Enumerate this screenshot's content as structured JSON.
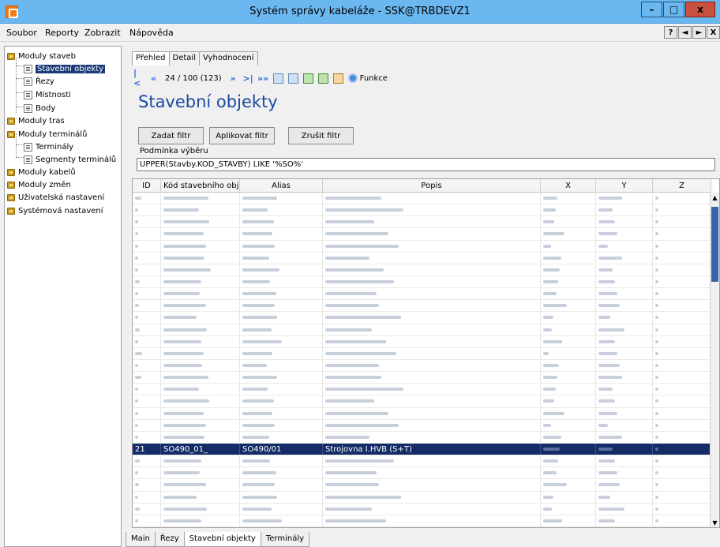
{
  "window": {
    "title": "Systém správy kabeláže - SSK@TRBDEVZ1"
  },
  "menu": [
    "Soubor",
    "Reporty",
    "Zobrazit",
    "Nápověda"
  ],
  "menu_right": [
    "?",
    "◄",
    "►",
    "X"
  ],
  "tree": {
    "modules_buildings": "Moduly staveb",
    "building_objects": "Stavební objekty",
    "sections": "Řezy",
    "rooms": "Místnosti",
    "points": "Body",
    "modules_routes": "Moduly tras",
    "modules_terminals": "Moduly terminálů",
    "terminals": "Terminály",
    "terminal_segments": "Segmenty terminálů",
    "modules_cables": "Moduly kabelů",
    "modules_changes": "Moduly změn",
    "user_settings": "Uživatelská nastavení",
    "system_settings": "Systémová nastavení"
  },
  "tabs": [
    "Přehled",
    "Detail",
    "Vyhodnocení"
  ],
  "toolbar": {
    "counter": "24 / 100 (123)",
    "funkce": "Funkce"
  },
  "heading": "Stavební objekty",
  "buttons": {
    "set_filter": "Zadat filtr",
    "apply_filter": "Aplikovat filtr",
    "cancel_filter": "Zrušit filtr"
  },
  "condition": {
    "label": "Podmínka výběru",
    "value": "UPPER(Stavby.KOD_STAVBY) LIKE '%SO%'"
  },
  "grid": {
    "columns": [
      "ID",
      "Kód stavebního objektu",
      "Alias",
      "Popis",
      "X",
      "Y",
      "Z"
    ],
    "selected_row": {
      "id": "21",
      "code": "SO490_01_",
      "alias": "SO490/01",
      "popis": "Strojovna I.HVB (S+T)"
    }
  },
  "bottom_tabs": [
    "Main",
    "Řezy",
    "Stavební objekty",
    "Terminály"
  ]
}
